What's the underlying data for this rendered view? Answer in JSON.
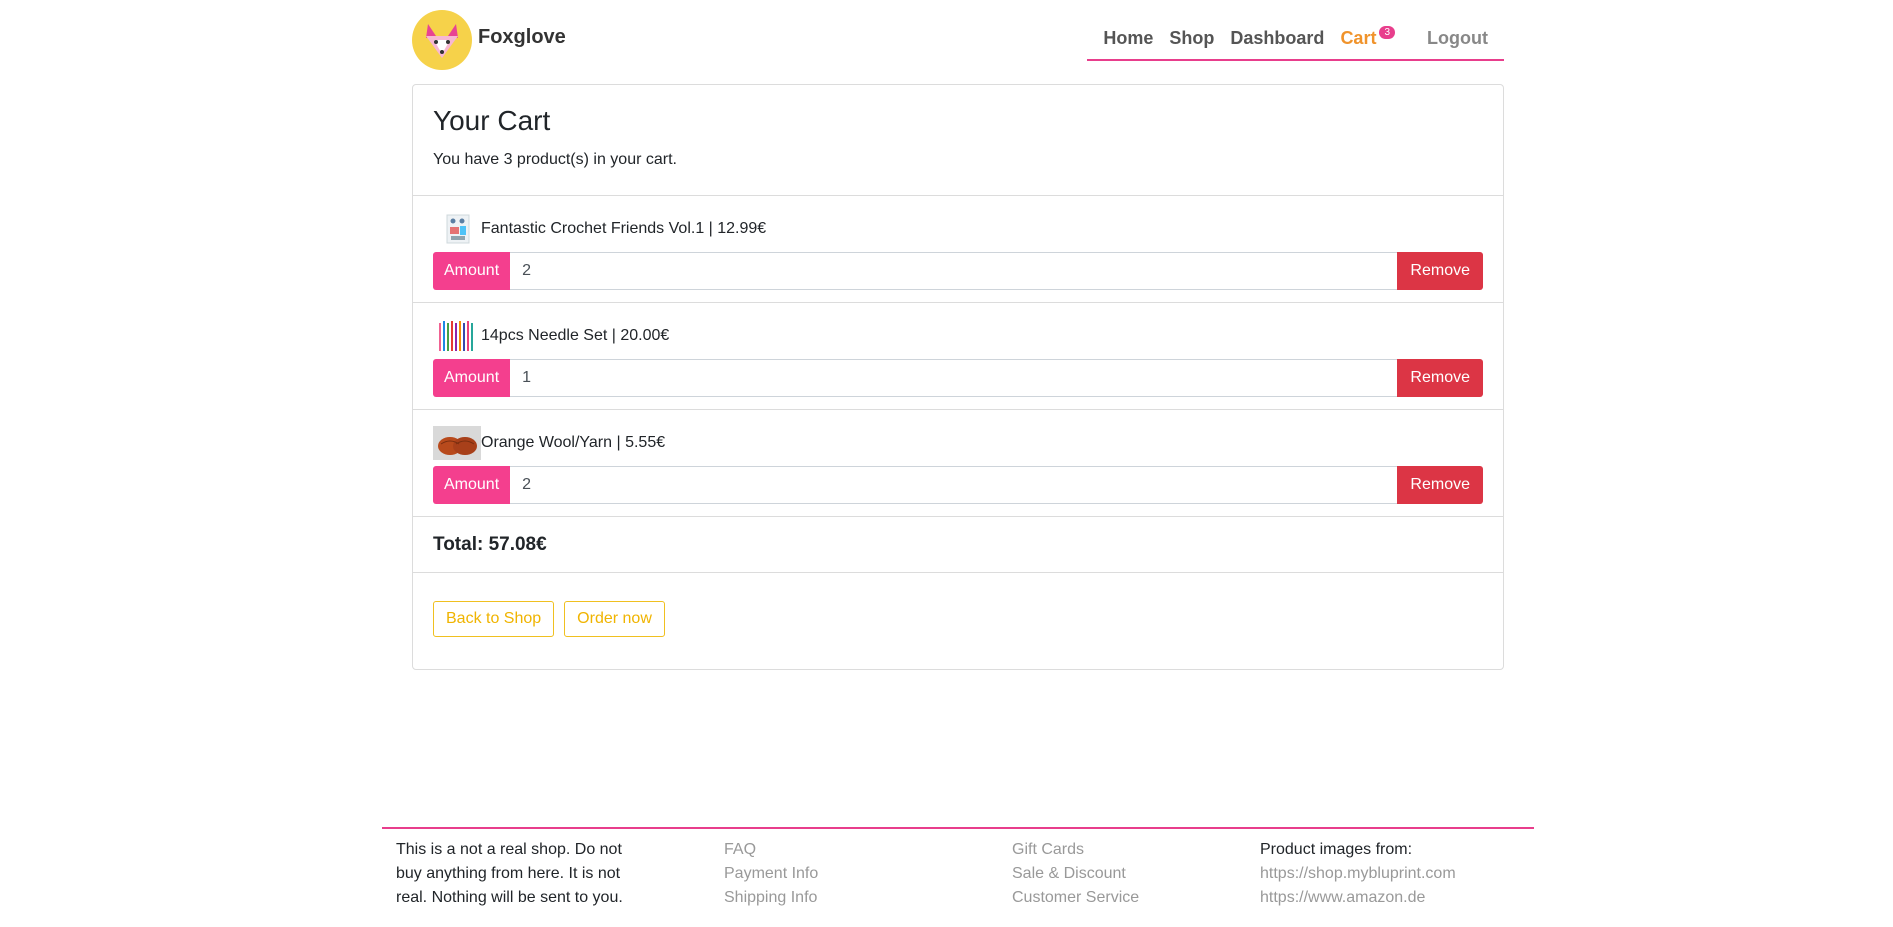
{
  "brand": {
    "name": "Foxglove",
    "colors": {
      "accent": "#e83e8c",
      "amount": "#f43f8e",
      "remove": "#dc3545",
      "outline": "#f0b400",
      "active_nav": "#f0932b",
      "logo_bg": "#f6d24a"
    }
  },
  "nav": {
    "home": "Home",
    "shop": "Shop",
    "dashboard": "Dashboard",
    "cart": "Cart",
    "cart_count": "3",
    "logout": "Logout"
  },
  "cart": {
    "title": "Your Cart",
    "summary": "You have 3 product(s) in your cart.",
    "amount_label": "Amount",
    "remove_label": "Remove",
    "items": [
      {
        "label": "Fantastic Crochet Friends Vol.1 | 12.99€",
        "amount": "2",
        "thumb_icon": "book-thumbnail-icon"
      },
      {
        "label": "14pcs Needle Set | 20.00€",
        "amount": "1",
        "thumb_icon": "needles-thumbnail-icon"
      },
      {
        "label": "Orange Wool/Yarn | 5.55€",
        "amount": "2",
        "thumb_icon": "yarn-thumbnail-icon"
      }
    ],
    "total": "Total: 57.08€",
    "back_button": "Back to Shop",
    "order_button": "Order now"
  },
  "footer": {
    "disclaimer": "This is a not a real shop. Do not buy anything from here. It is not real. Nothing will be sent to you.",
    "col2": [
      "FAQ",
      "Payment Info",
      "Shipping Info"
    ],
    "col3": [
      "Gift Cards",
      "Sale & Discount",
      "Customer Service"
    ],
    "col4_title": "Product images from:",
    "col4": [
      "https://shop.mybluprint.com",
      "https://www.amazon.de"
    ]
  }
}
